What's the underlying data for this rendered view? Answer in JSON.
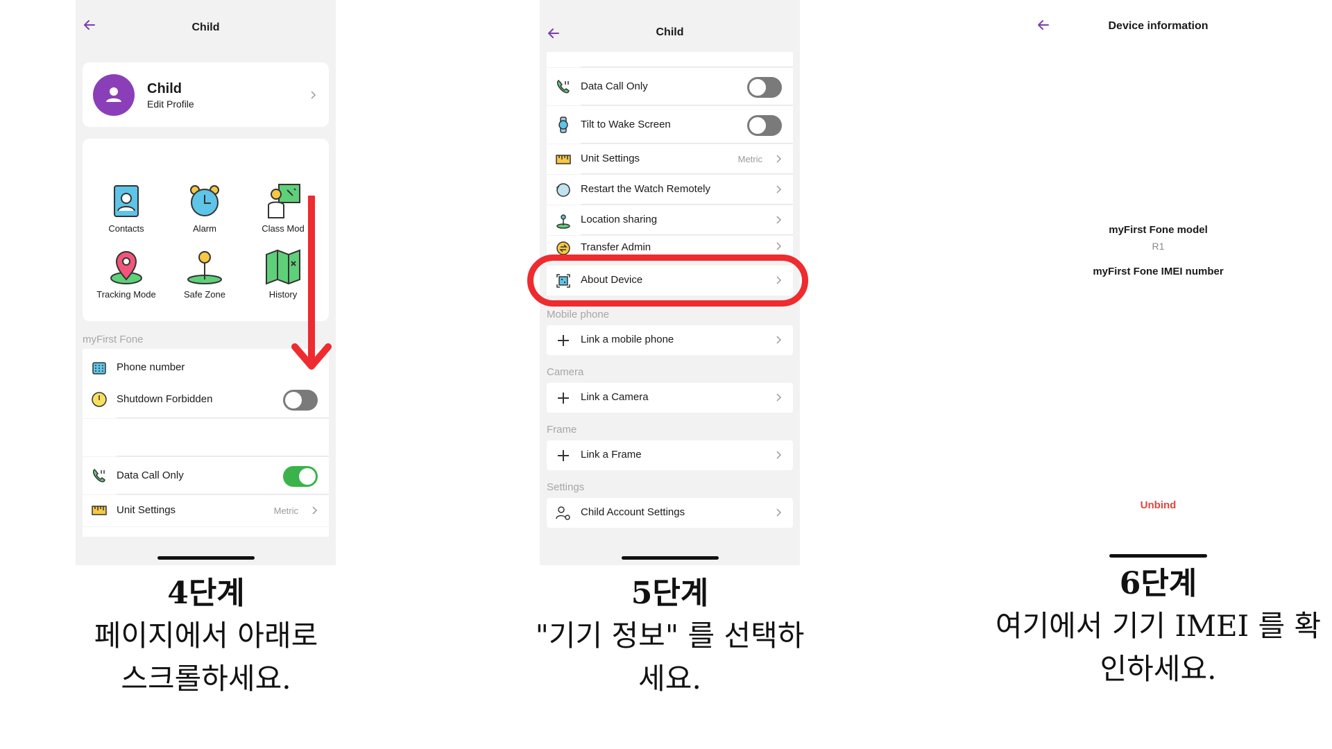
{
  "steps": {
    "step4": {
      "screen": {
        "title": "Child",
        "profile": {
          "name": "Child",
          "subtitle": "Edit Profile"
        },
        "tiles": [
          {
            "label": "Contacts",
            "icon": "contacts-icon"
          },
          {
            "label": "Alarm",
            "icon": "alarm-clock-icon"
          },
          {
            "label": "Class Mod",
            "icon": "class-mode-icon"
          },
          {
            "label": "Tracking Mode",
            "icon": "location-pin-icon"
          },
          {
            "label": "Safe Zone",
            "icon": "safe-zone-icon"
          },
          {
            "label": "History",
            "icon": "map-history-icon"
          }
        ],
        "section": "myFirst Fone",
        "rows": [
          {
            "label": "Phone number",
            "icon": "phone-icon"
          },
          {
            "label": "Shutdown Forbidden",
            "icon": "power-icon",
            "toggle": "off"
          },
          {
            "label": "Data Call Only",
            "icon": "data-call-icon",
            "toggle": "on"
          },
          {
            "label": "Unit Settings",
            "icon": "ruler-icon",
            "value": "Metric"
          }
        ]
      },
      "caption": {
        "step": "4단계",
        "line1": "페이지에서 아래로",
        "line2": "스크롤하세요."
      }
    },
    "step5": {
      "screen": {
        "title": "Child",
        "rows": [
          {
            "label": "Data Call Only",
            "icon": "data-call-icon",
            "toggle": "off"
          },
          {
            "label": "Tilt to Wake Screen",
            "icon": "watch-icon",
            "toggle": "off"
          },
          {
            "label": "Unit Settings",
            "icon": "ruler-icon",
            "value": "Metric"
          },
          {
            "label": "Restart the Watch Remotely",
            "icon": "restart-icon"
          },
          {
            "label": "Location sharing",
            "icon": "location-share-icon"
          },
          {
            "label": "Transfer Admin",
            "icon": "transfer-icon"
          },
          {
            "label": "About Device",
            "icon": "device-qr-icon"
          }
        ],
        "sections": [
          {
            "label": "Mobile phone",
            "action": "Link a mobile phone"
          },
          {
            "label": "Camera",
            "action": "Link a Camera"
          },
          {
            "label": "Frame",
            "action": "Link a Frame"
          },
          {
            "label": "Settings",
            "action": "Child Account Settings"
          }
        ]
      },
      "caption": {
        "step": "5단계",
        "line1": "\"기기 정보\" 를 선택하",
        "line2": "세요."
      }
    },
    "step6": {
      "screen": {
        "title": "Device information",
        "model_label": "myFirst Fone model",
        "model_value": "R1",
        "imei_label": "myFirst Fone IMEI number",
        "unbind": "Unbind"
      },
      "caption": {
        "step": "6단계",
        "line1": "여기에서 기기 IMEI 를 확",
        "line2": "인하세요."
      }
    }
  },
  "colors": {
    "accent": "#7b3db0",
    "toggle_on": "#3bb34a",
    "highlight": "#ee2b2f",
    "unbind": "#e0463c"
  }
}
